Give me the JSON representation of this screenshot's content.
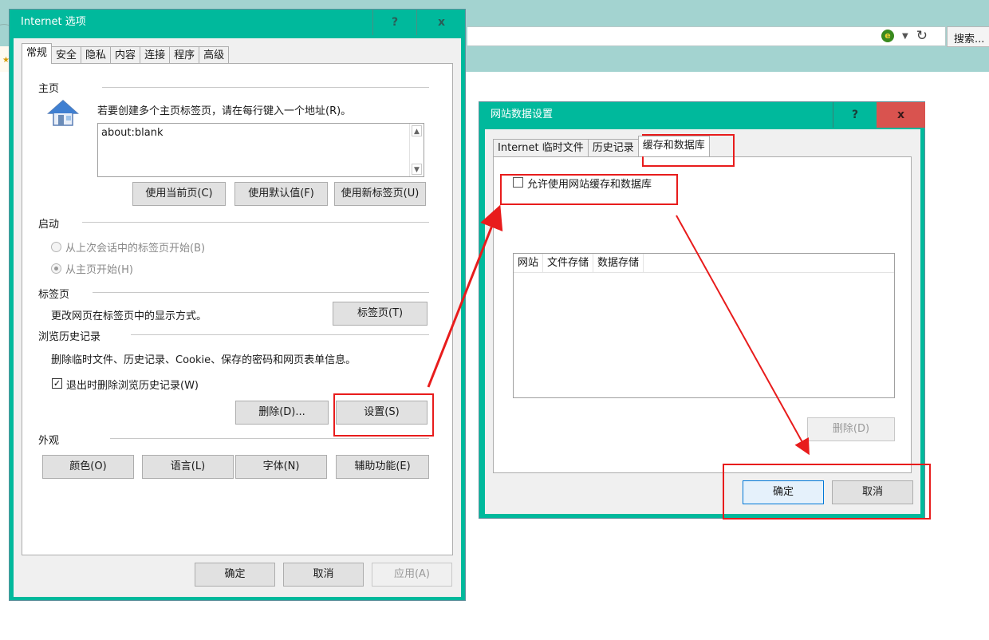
{
  "browser": {
    "search_label": "搜索...",
    "icons": [
      "compat-view-icon",
      "dropdown-icon",
      "refresh-icon"
    ]
  },
  "internet_options": {
    "title": "Internet 选项",
    "help_label": "?",
    "close_label": "x",
    "tabs": [
      "常规",
      "安全",
      "隐私",
      "内容",
      "连接",
      "程序",
      "高级"
    ],
    "active_tab": "常规",
    "homepage": {
      "section": "主页",
      "description": "若要创建多个主页标签页，请在每行键入一个地址(R)。",
      "value": "about:blank",
      "btn_current": "使用当前页(C)",
      "btn_default": "使用默认值(F)",
      "btn_newtab": "使用新标签页(U)"
    },
    "startup": {
      "section": "启动",
      "option_last": "从上次会话中的标签页开始(B)",
      "option_home": "从主页开始(H)",
      "selected": "从主页开始(H)"
    },
    "tabs_section": {
      "section": "标签页",
      "description": "更改网页在标签页中的显示方式。",
      "button": "标签页(T)"
    },
    "history": {
      "section": "浏览历史记录",
      "description": "删除临时文件、历史记录、Cookie、保存的密码和网页表单信息。",
      "checkbox_label": "退出时删除浏览历史记录(W)",
      "checkbox_checked": true,
      "delete_btn": "删除(D)...",
      "settings_btn": "设置(S)"
    },
    "appearance": {
      "section": "外观",
      "colors": "颜色(O)",
      "languages": "语言(L)",
      "fonts": "字体(N)",
      "accessibility": "辅助功能(E)"
    },
    "footer": {
      "ok": "确定",
      "cancel": "取消",
      "apply": "应用(A)"
    }
  },
  "website_data": {
    "title": "网站数据设置",
    "help_label": "?",
    "close_label": "x",
    "tabs": [
      "Internet 临时文件",
      "历史记录",
      "缓存和数据库"
    ],
    "active_tab": "缓存和数据库",
    "allow_label": "允许使用网站缓存和数据库",
    "allow_checked": false,
    "columns": [
      "网站",
      "文件存储",
      "数据存储"
    ],
    "delete_btn": "删除(D)",
    "ok": "确定",
    "cancel": "取消"
  },
  "colors": {
    "titlebar": "#00b99c",
    "close_red": "#d9534f",
    "annotation_red": "#e81c1c"
  }
}
